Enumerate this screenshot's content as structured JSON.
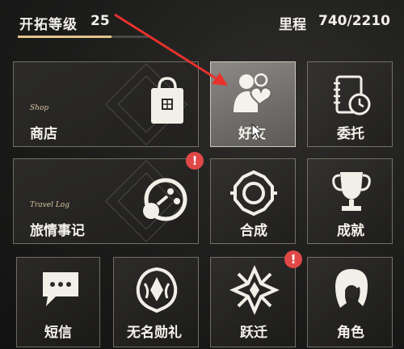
{
  "header": {
    "level_label": "开拓等级",
    "level_value": "25",
    "level_progress": 0.7,
    "mileage_label": "里程",
    "mileage_value": "740/2210"
  },
  "colors": {
    "accent_gold": "#e4c58f",
    "badge_red": "#e04848",
    "arrow_red": "#e8322c"
  },
  "tiles": {
    "shop": {
      "label": "商店",
      "subtitle": "Shop",
      "icon": "shopping-bag-icon"
    },
    "friends": {
      "label": "好友",
      "icon": "friends-heart-icon"
    },
    "commission": {
      "label": "委托",
      "icon": "commission-journal-icon"
    },
    "travel_log": {
      "label": "旅情事记",
      "subtitle": "Travel Log",
      "icon": "travel-log-icon",
      "badge": "!"
    },
    "synthesis": {
      "label": "合成",
      "icon": "synthesis-icon"
    },
    "achievements": {
      "label": "成就",
      "icon": "trophy-icon"
    },
    "messages": {
      "label": "短信",
      "icon": "message-bubble-icon"
    },
    "nameless_honor": {
      "label": "无名勋礼",
      "icon": "nameless-honor-icon"
    },
    "warp": {
      "label": "跃迁",
      "icon": "warp-icon",
      "badge": "!"
    },
    "characters": {
      "label": "角色",
      "icon": "character-icon"
    }
  }
}
